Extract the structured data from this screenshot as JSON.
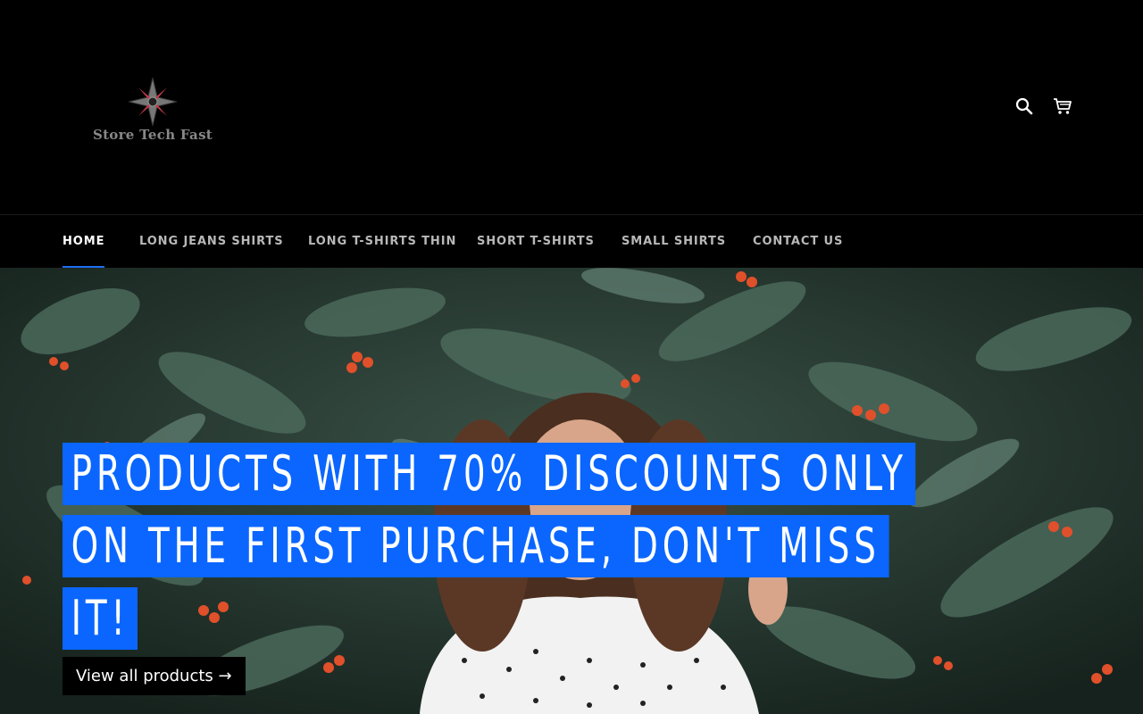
{
  "brand": {
    "name": "Store Tech Fast",
    "accent_color": "#0a66ff",
    "logo_icon": "compass-star-icon"
  },
  "header": {
    "search_icon": "search-icon",
    "cart_icon": "cart-icon"
  },
  "nav": {
    "items": [
      {
        "label": "HOME",
        "active": true
      },
      {
        "label": "LONG JEANS SHIRTS",
        "active": false
      },
      {
        "label": "LONG T-SHIRTS THIN",
        "active": false
      },
      {
        "label": "SHORT T-SHIRTS",
        "active": false
      },
      {
        "label": "SMALL SHIRTS",
        "active": false
      },
      {
        "label": "CONTACT US",
        "active": false
      }
    ]
  },
  "hero": {
    "title_lines": [
      "PRODUCTS WITH 70% DISCOUNTS ONLY",
      "ON THE FIRST PURCHASE, DON'T MISS",
      "IT!"
    ],
    "cta_label": "View all products →"
  }
}
